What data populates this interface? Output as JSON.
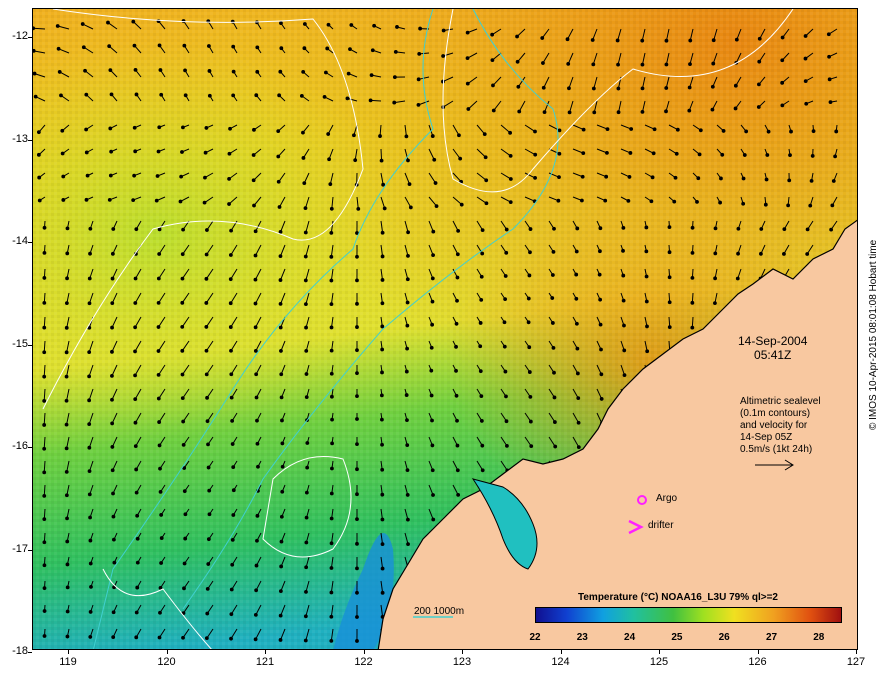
{
  "map": {
    "lat_labels": [
      "-12",
      "-13",
      "-14",
      "-15",
      "-16",
      "-17",
      "-18"
    ],
    "lon_labels": [
      "119",
      "120",
      "121",
      "122",
      "123",
      "124",
      "125",
      "126",
      "127"
    ],
    "colors": {
      "land": "#f8c8a0",
      "ocean_warm": "#f0a020",
      "ocean_mid": "#e6e020",
      "ocean_cool": "#40c050",
      "ocean_cold": "#10b0e0",
      "contour_white": "#ffffff",
      "isobath_cyan": "#40d0d0",
      "marker_magenta": "#ff20ff"
    }
  },
  "annotations": {
    "date": "14-Sep-2004",
    "time": "05:41Z",
    "alt_lines": [
      "Altimetric sealevel",
      "(0.1m contours)",
      "and velocity for",
      "14-Sep 05Z",
      "0.5m/s (1kt 24h)"
    ],
    "argo": "Argo",
    "drifter": "drifter",
    "depth_legend": "200  1000m"
  },
  "colorbar": {
    "title": "Temperature (°C) NOAA16_L3U 79% ql>=2",
    "labels": [
      "22",
      "23",
      "24",
      "25",
      "26",
      "27",
      "28"
    ]
  },
  "credit": "© IMOS 10-Apr-2015 08:01:08 Hobart time"
}
